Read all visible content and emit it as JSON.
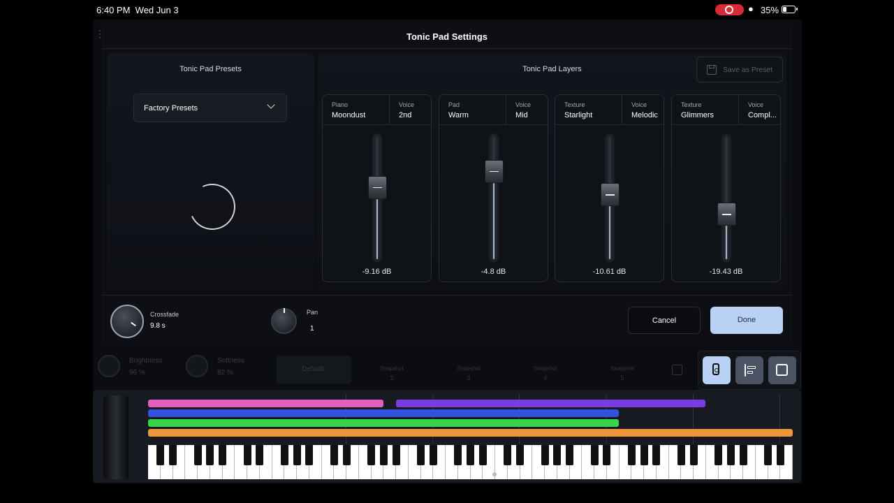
{
  "status": {
    "time": "6:40 PM",
    "date": "Wed Jun 3",
    "battery": "35%"
  },
  "modal": {
    "title": "Tonic Pad Settings"
  },
  "presets_panel": {
    "title": "Tonic Pad Presets",
    "dropdown_label": "Factory Presets"
  },
  "layers_panel": {
    "title": "Tonic Pad Layers",
    "save_label": "Save as Preset",
    "cards": [
      {
        "type_label": "Piano",
        "type_value": "Moondust",
        "voice_label": "Voice",
        "voice_value": "2nd",
        "db": "-9.16 dB",
        "level": 0.6
      },
      {
        "type_label": "Pad",
        "type_value": "Warm",
        "voice_label": "Voice",
        "voice_value": "Mid",
        "db": "-4.8 dB",
        "level": 0.75
      },
      {
        "type_label": "Texture",
        "type_value": "Starlight",
        "voice_label": "Voice",
        "voice_value": "Melodic",
        "db": "-10.61 dB",
        "level": 0.53
      },
      {
        "type_label": "Texture",
        "type_value": "Glimmers",
        "voice_label": "Voice",
        "voice_value": "Compl...",
        "db": "-19.43 dB",
        "level": 0.35
      }
    ]
  },
  "controls": {
    "crossfade_label": "Crossfade",
    "crossfade_value": "9.8 s",
    "pan_label": "Pan",
    "pan_value": "1",
    "cancel_label": "Cancel",
    "done_label": "Done"
  },
  "background_row": {
    "knob1_label": "Brightness",
    "knob1_value": "96 %",
    "knob2_label": "Softness",
    "knob2_value": "82 %",
    "default_label": "Default",
    "snapshots": [
      {
        "label": "Snapshot",
        "n": "2"
      },
      {
        "label": "Snapshot",
        "n": "3"
      },
      {
        "label": "Snapshot",
        "n": "4"
      },
      {
        "label": "Snapshot",
        "n": "5"
      }
    ]
  },
  "mode_icons": [
    "sound-icon",
    "align-icon",
    "piano-icon"
  ],
  "colors": {
    "accent": "#b9d1f4",
    "pink": "#e05fbf",
    "purple": "#7c3be0",
    "blue": "#3352e0",
    "green": "#37d64a",
    "orange": "#f0963a"
  }
}
